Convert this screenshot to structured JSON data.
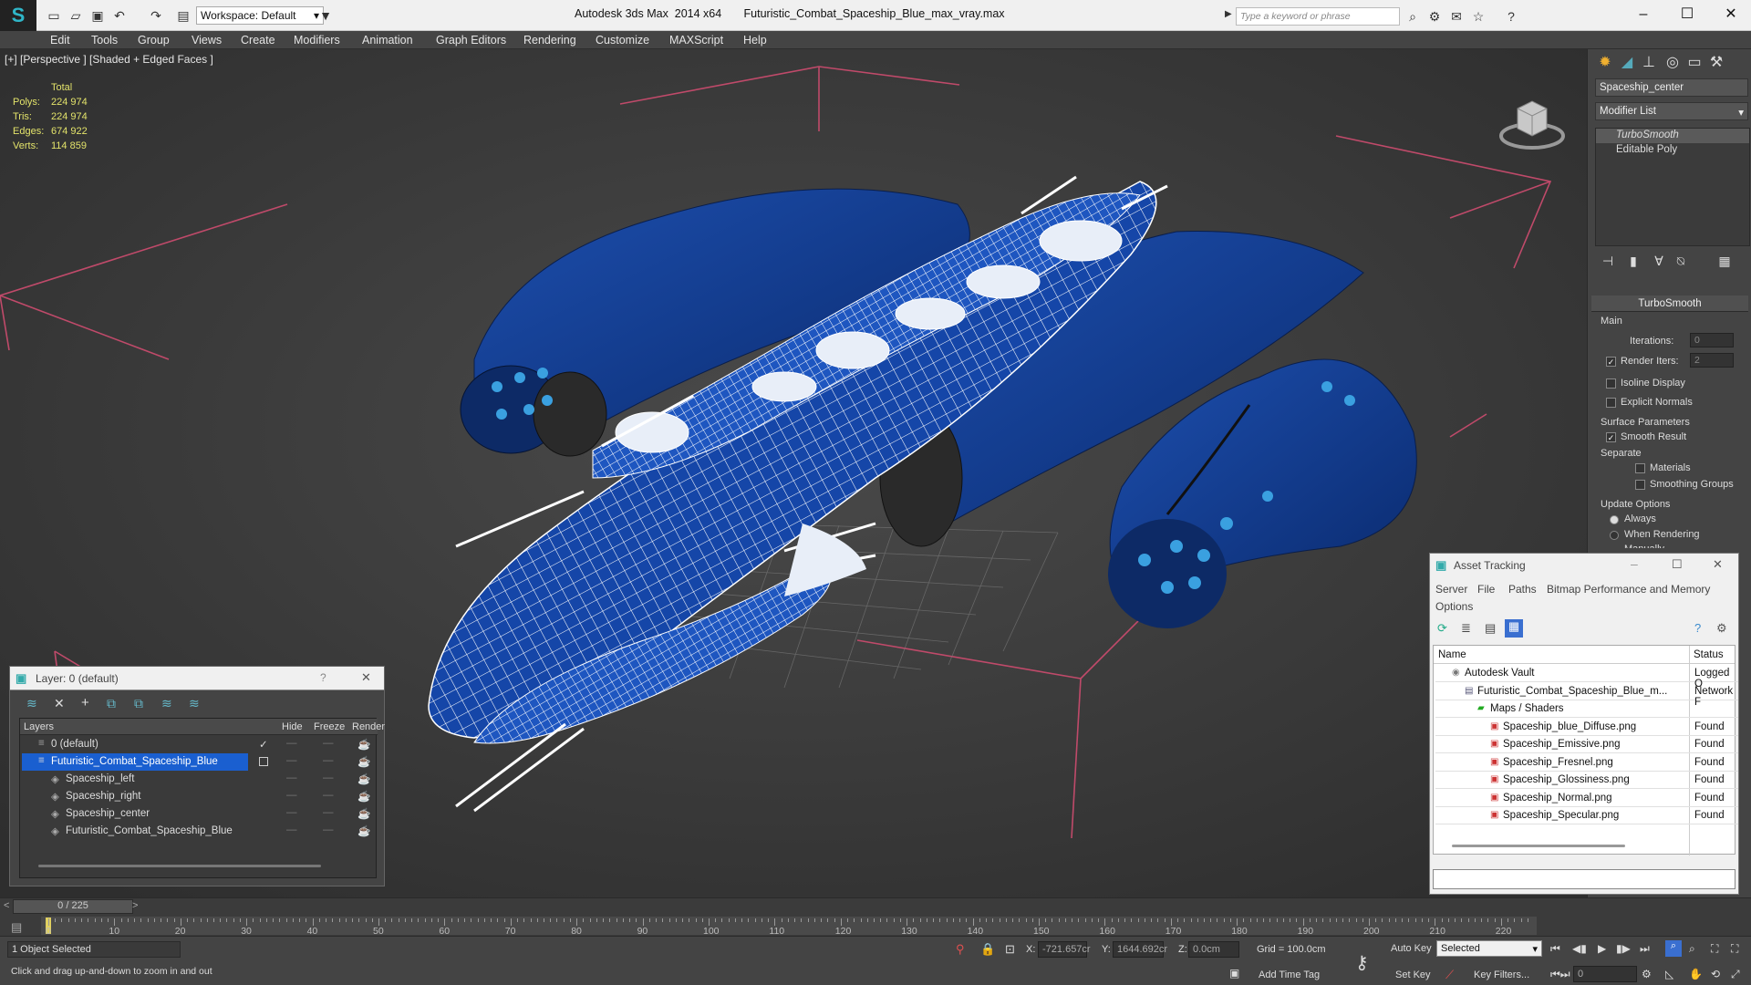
{
  "titlebar": {
    "workspace": "Workspace: Default",
    "app_title": "Autodesk 3ds Max  2014 x64       Futuristic_Combat_Spaceship_Blue_max_vray.max",
    "search_placeholder": "Type a keyword or phrase"
  },
  "menu": [
    "Edit",
    "Tools",
    "Group",
    "Views",
    "Create",
    "Modifiers",
    "Animation",
    "Graph Editors",
    "Rendering",
    "Customize",
    "MAXScript",
    "Help"
  ],
  "viewport": {
    "label": "[+] [Perspective ] [Shaded + Edged Faces ]",
    "stats_header": "Total",
    "stats": [
      {
        "label": "Polys:",
        "value": "224 974"
      },
      {
        "label": "Tris:",
        "value": "224 974"
      },
      {
        "label": "Edges:",
        "value": "674 922"
      },
      {
        "label": "Verts:",
        "value": "114 859"
      }
    ]
  },
  "command_panel": {
    "object_name": "Spaceship_center",
    "modifier_list": "Modifier List",
    "stack": [
      "TurboSmooth",
      "Editable Poly"
    ],
    "turbosmooth": {
      "title": "TurboSmooth",
      "main": "Main",
      "iterations_label": "Iterations:",
      "iterations": "0",
      "render_iters_label": "Render Iters:",
      "render_iters": "2",
      "isoline": "Isoline Display",
      "explicit_normals": "Explicit Normals",
      "surface_params": "Surface Parameters",
      "smooth_result": "Smooth Result",
      "separate": "Separate",
      "materials": "Materials",
      "smoothing_groups": "Smoothing Groups",
      "update_options": "Update Options",
      "always": "Always",
      "when_rendering": "When Rendering",
      "manually": "Manually"
    }
  },
  "layer_dialog": {
    "title": "Layer: 0 (default)",
    "help": "?",
    "columns": [
      "Layers",
      "Hide",
      "Freeze",
      "Render"
    ],
    "rows": [
      {
        "name": "0 (default)",
        "indent": 0
      },
      {
        "name": "Futuristic_Combat_Spaceship_Blue",
        "indent": 0
      },
      {
        "name": "Spaceship_left",
        "indent": 1
      },
      {
        "name": "Spaceship_right",
        "indent": 1
      },
      {
        "name": "Spaceship_center",
        "indent": 1
      },
      {
        "name": "Futuristic_Combat_Spaceship_Blue",
        "indent": 1
      }
    ]
  },
  "asset_dialog": {
    "title": "Asset Tracking",
    "menu": [
      "Server",
      "File",
      "Paths",
      "Bitmap Performance and Memory"
    ],
    "menu2": "Options",
    "columns": [
      "Name",
      "Status"
    ],
    "rows": [
      {
        "name": "Autodesk Vault",
        "status": "Logged O",
        "indent": 1
      },
      {
        "name": "Futuristic_Combat_Spaceship_Blue_m...",
        "status": "Network F",
        "indent": 2
      },
      {
        "name": "Maps / Shaders",
        "status": "",
        "indent": 3
      },
      {
        "name": "Spaceship_blue_Diffuse.png",
        "status": "Found",
        "indent": 4
      },
      {
        "name": "Spaceship_Emissive.png",
        "status": "Found",
        "indent": 4
      },
      {
        "name": "Spaceship_Fresnel.png",
        "status": "Found",
        "indent": 4
      },
      {
        "name": "Spaceship_Glossiness.png",
        "status": "Found",
        "indent": 4
      },
      {
        "name": "Spaceship_Normal.png",
        "status": "Found",
        "indent": 4
      },
      {
        "name": "Spaceship_Specular.png",
        "status": "Found",
        "indent": 4
      }
    ]
  },
  "timeline": {
    "frame": "0 / 225",
    "ticks": [
      "0",
      "10",
      "20",
      "30",
      "40",
      "50",
      "60",
      "70",
      "80",
      "90",
      "100",
      "110",
      "120",
      "130",
      "140",
      "150",
      "160",
      "170",
      "180",
      "190",
      "200",
      "210",
      "220"
    ]
  },
  "status": {
    "selected": "1 Object Selected",
    "hint": "Click and drag up-and-down to zoom in and out",
    "x_label": "X:",
    "x": "-721.657cr",
    "y_label": "Y:",
    "y": "1644.692cr",
    "z_label": "Z:",
    "z": "0.0cm",
    "grid": "Grid = 100.0cm",
    "add_time_tag": "Add Time Tag",
    "auto_key": "Auto Key",
    "set_key": "Set Key",
    "key_mode": "Selected",
    "key_filters": "Key Filters...",
    "frame_value": "0"
  }
}
